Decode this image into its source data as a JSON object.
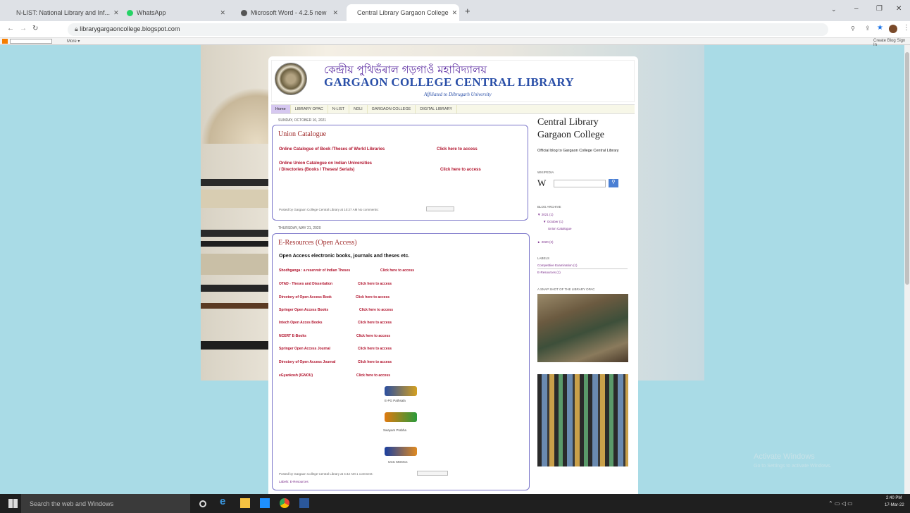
{
  "tabs": [
    {
      "label": "N-LIST: National Library and Inf...",
      "color": "#f29a1a"
    },
    {
      "label": "WhatsApp",
      "color": "#25d366"
    },
    {
      "label": "Microsoft Word - 4.2.5 new",
      "color": "#555555"
    },
    {
      "label": "Central Library Gargaon College",
      "color": "#c8a030"
    }
  ],
  "address": "librarygargaoncollege.blogspot.com",
  "bloggerbar": {
    "more": "More ▾",
    "create": "Create Blog  Sign In"
  },
  "header": {
    "bengali": "কেন্দ্ৰীয় পুথিভঁৰাল গড়গাওঁ মহাবিদ্যালয়",
    "title": "GARGAON COLLEGE CENTRAL LIBRARY",
    "affiliation": "Affiliated to Dibrugarh University"
  },
  "menu": [
    "Home",
    "LIBRARY OPAC",
    "N-LIST",
    "NDLI",
    "GARGAON COLLEGE",
    "DIGITAL LIBRARY"
  ],
  "post1": {
    "date": "Sunday, October 10, 2021",
    "title": "Union Catalogue",
    "link1": "Online Catalogue of  Book /Theses of  World Libraries",
    "access1": "Click here to access",
    "link2a": "Online Union Catalogue on Indian Universities",
    "link2b": "/ Directories (Books / Theses/ Serials)",
    "access2": "Click here to access",
    "footer": "Posted by Gargaon College Central Library at 10:27 AM    No comments:"
  },
  "post2": {
    "date": "Thursday, May 21, 2020",
    "title": "E-Resources (Open Access)",
    "intro": "Open Access electronic books, journals and theses etc.",
    "resources": [
      {
        "name": "Shodhganga : a reservoir of Indian Theses",
        "access": "Click here to access"
      },
      {
        "name": "OTAD - Theses and Dissertation",
        "access": "Click here to access"
      },
      {
        "name": "Directory of Open Access Book",
        "access": "Click here to access"
      },
      {
        "name": "Springer Open Access Books",
        "access": "Click here to access"
      },
      {
        "name": "Intech Open Acces Books",
        "access": "Click here to access"
      },
      {
        "name": "NCERT E-Books",
        "access": "Click here to access"
      },
      {
        "name": "Springer Open Access Journal",
        "access": "Click here to access"
      },
      {
        "name": "Directory of Open Access Journal",
        "access": "Click here to access"
      },
      {
        "name": "eGyankosh (IGNOU)",
        "access": "Click here to access"
      }
    ],
    "logos": [
      "E-PG Pathsala",
      "Swayam Prabha",
      "UGC MOOCs"
    ],
    "footer": "Posted by Gargaon College Central Library at 4:42 AM    1 comment:",
    "labels": "Labels: E-Resources"
  },
  "sidebar": {
    "title1": "Central Library",
    "title2": "Gargaon College",
    "desc": "Official blog to Gargaon College Central Library",
    "wiki": "Wikipedia",
    "archive": "Blog Archive",
    "a2021": "▼ 2021 (1)",
    "oct": "▼ October (1)",
    "uc": "Union Catalogue",
    "a2020": "► 2020 (2)",
    "labels": "Labels",
    "l1": "Competitive Examination (1)",
    "l2": "E-Resources (1)",
    "snap": "A Snap Shot of the Library OPAC"
  },
  "watermark": {
    "line1": "Activate Windows",
    "line2": "Go to Settings to activate Windows."
  },
  "taskbar": {
    "search": "Search the web and Windows",
    "time": "2:40 PM",
    "date": "17-Mar-22"
  }
}
